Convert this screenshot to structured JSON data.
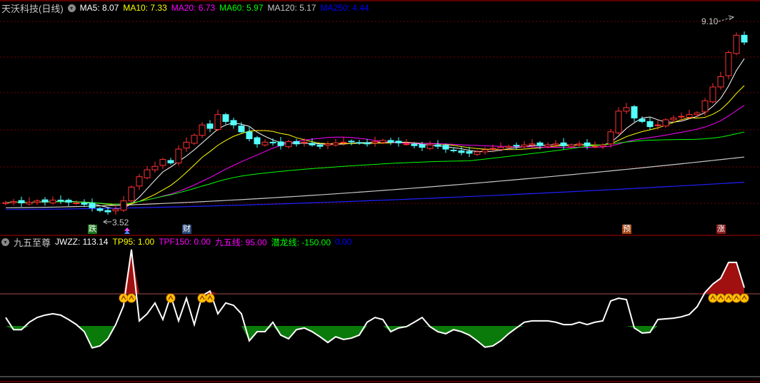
{
  "main_panel": {
    "title": "天沃科技(日线)",
    "ma_labels": [
      {
        "text": "MA5: 8.07",
        "color": "#ffffff"
      },
      {
        "text": "MA10: 7.33",
        "color": "#ffff00"
      },
      {
        "text": "MA20: 6.73",
        "color": "#ff00ff"
      },
      {
        "text": "MA60: 5.97",
        "color": "#00ff00"
      },
      {
        "text": "MA120: 5.17",
        "color": "#c8c8c8"
      },
      {
        "text": "MA250: 4.44",
        "color": "#0000ff"
      }
    ],
    "high_label": "9.10",
    "low_label": "3.52",
    "signals": [
      {
        "text": "跌",
        "index": 11,
        "bg": "#1f7a1f"
      },
      {
        "text": "财",
        "index": 23,
        "bg": "#2a4a7a"
      },
      {
        "text": "预",
        "index": 79,
        "bg": "#a84a1a"
      },
      {
        "text": "涨",
        "index": 91,
        "bg": "#8a1a1a"
      }
    ]
  },
  "indicator_panel": {
    "title": "九五至尊",
    "labels": [
      {
        "text": "JWZZ: 113.14",
        "color": "#ffffff"
      },
      {
        "text": "TP95: 1.00",
        "color": "#ffff00"
      },
      {
        "text": "TPF150: 0.00",
        "color": "#ff00ff"
      },
      {
        "text": "九五线: 95.00",
        "color": "#ff00ff"
      },
      {
        "text": "潜龙线: -150.00",
        "color": "#00ff00"
      },
      {
        "text": "0.00",
        "color": "#0000ff"
      }
    ]
  },
  "colors": {
    "up": "#ff3232",
    "down": "#54ffff",
    "grid": "#7a0000",
    "frame": "#b00000"
  },
  "chart_data": [
    {
      "type": "candlestick",
      "title": "天沃科技(日线)",
      "ylim": [
        3.52,
        9.1
      ],
      "closes": [
        3.85,
        3.88,
        3.84,
        3.86,
        3.9,
        3.87,
        3.92,
        3.89,
        3.86,
        3.84,
        3.8,
        3.7,
        3.62,
        3.58,
        3.66,
        3.9,
        4.3,
        4.6,
        4.8,
        4.9,
        5.1,
        5.0,
        5.4,
        5.6,
        5.8,
        6.1,
        6.0,
        6.4,
        6.2,
        6.1,
        5.9,
        5.7,
        5.55,
        5.6,
        5.58,
        5.5,
        5.62,
        5.55,
        5.6,
        5.52,
        5.48,
        5.55,
        5.58,
        5.6,
        5.62,
        5.58,
        5.55,
        5.62,
        5.65,
        5.6,
        5.58,
        5.55,
        5.5,
        5.45,
        5.52,
        5.48,
        5.4,
        5.35,
        5.3,
        5.28,
        5.32,
        5.38,
        5.42,
        5.45,
        5.48,
        5.5,
        5.52,
        5.55,
        5.5,
        5.52,
        5.55,
        5.5,
        5.52,
        5.55,
        5.5,
        5.48,
        5.52,
        5.9,
        6.5,
        6.6,
        6.3,
        6.2,
        6.05,
        6.1,
        6.25,
        6.3,
        6.35,
        6.4,
        6.45,
        6.8,
        7.2,
        7.5,
        8.2,
        8.7,
        8.5
      ],
      "ma120_range": [
        3.7,
        5.17
      ],
      "ma250_range": [
        3.65,
        4.44
      ]
    },
    {
      "type": "line",
      "title": "九五至尊",
      "series": "JWZZ",
      "ylim": [
        -150,
        226
      ],
      "reference_lines": [
        95,
        0,
        -150
      ],
      "values": [
        25,
        -11,
        -11,
        11,
        25,
        32,
        36,
        32,
        19,
        4,
        -17,
        -65,
        -59,
        -38,
        4,
        60,
        226,
        15,
        36,
        68,
        19,
        89,
        15,
        82,
        4,
        89,
        103,
        36,
        68,
        61,
        36,
        -44,
        -17,
        -17,
        11,
        -27,
        -38,
        -11,
        -6,
        -17,
        -32,
        -49,
        -32,
        -40,
        -36,
        -27,
        11,
        25,
        19,
        -17,
        -6,
        -2,
        11,
        25,
        -2,
        -17,
        -23,
        -11,
        -17,
        -27,
        -44,
        -63,
        -59,
        -44,
        -23,
        -6,
        11,
        15,
        15,
        15,
        11,
        4,
        4,
        11,
        4,
        11,
        15,
        74,
        82,
        78,
        -6,
        -21,
        -19,
        19,
        21,
        23,
        27,
        34,
        57,
        99,
        124,
        141,
        188,
        188,
        113.14
      ],
      "signal_indices": [
        15,
        16,
        21,
        25,
        26,
        90,
        91,
        92,
        93,
        94
      ]
    }
  ]
}
